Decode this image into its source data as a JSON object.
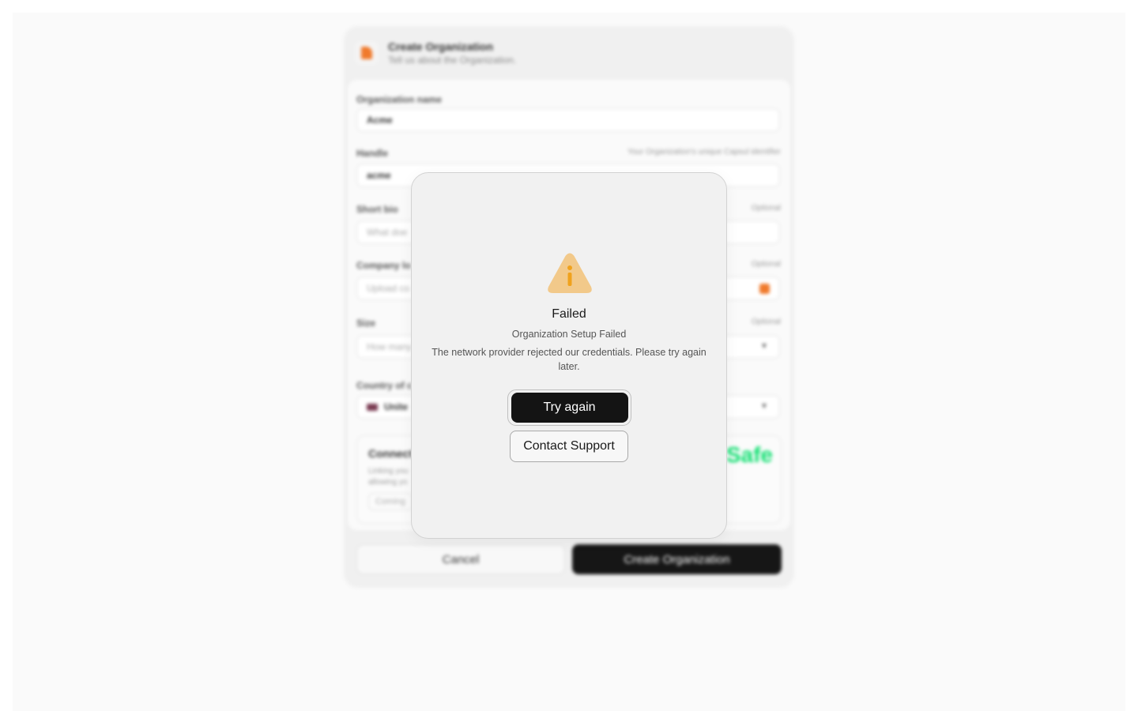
{
  "background_form": {
    "title": "Create Organization",
    "subtitle": "Tell us about the Organization.",
    "fields": {
      "org_name": {
        "label": "Organization name",
        "value": "Acme"
      },
      "handle": {
        "label": "Handle",
        "hint": "Your Organization's unique Capsul identifier",
        "value": "acme"
      },
      "bio": {
        "label": "Short bio",
        "hint": "Optional",
        "placeholder": "What doe"
      },
      "logo": {
        "label": "Company lo",
        "hint": "Optional",
        "placeholder": "Upload co"
      },
      "size": {
        "label": "Size",
        "hint": "Optional",
        "placeholder": "How many"
      },
      "country": {
        "label": "Country of c",
        "value": "Unite"
      }
    },
    "connect": {
      "title": "Connect",
      "description": "Linking you allowing yo",
      "pill": "Coming",
      "partner_logo": "Safe"
    },
    "cancel_label": "Cancel",
    "create_label": "Create Organization"
  },
  "modal": {
    "icon": "warning-icon",
    "title": "Failed",
    "subtitle": "Organization Setup Failed",
    "message": "The network provider rejected our credentials. Please try again later.",
    "primary_label": "Try again",
    "secondary_label": "Contact Support"
  },
  "colors": {
    "warning_fill": "#f2c98a",
    "warning_glyph": "#f0a21d",
    "brand_orange": "#f07a2c",
    "safe_green": "#12e072",
    "primary_button": "#141414"
  }
}
